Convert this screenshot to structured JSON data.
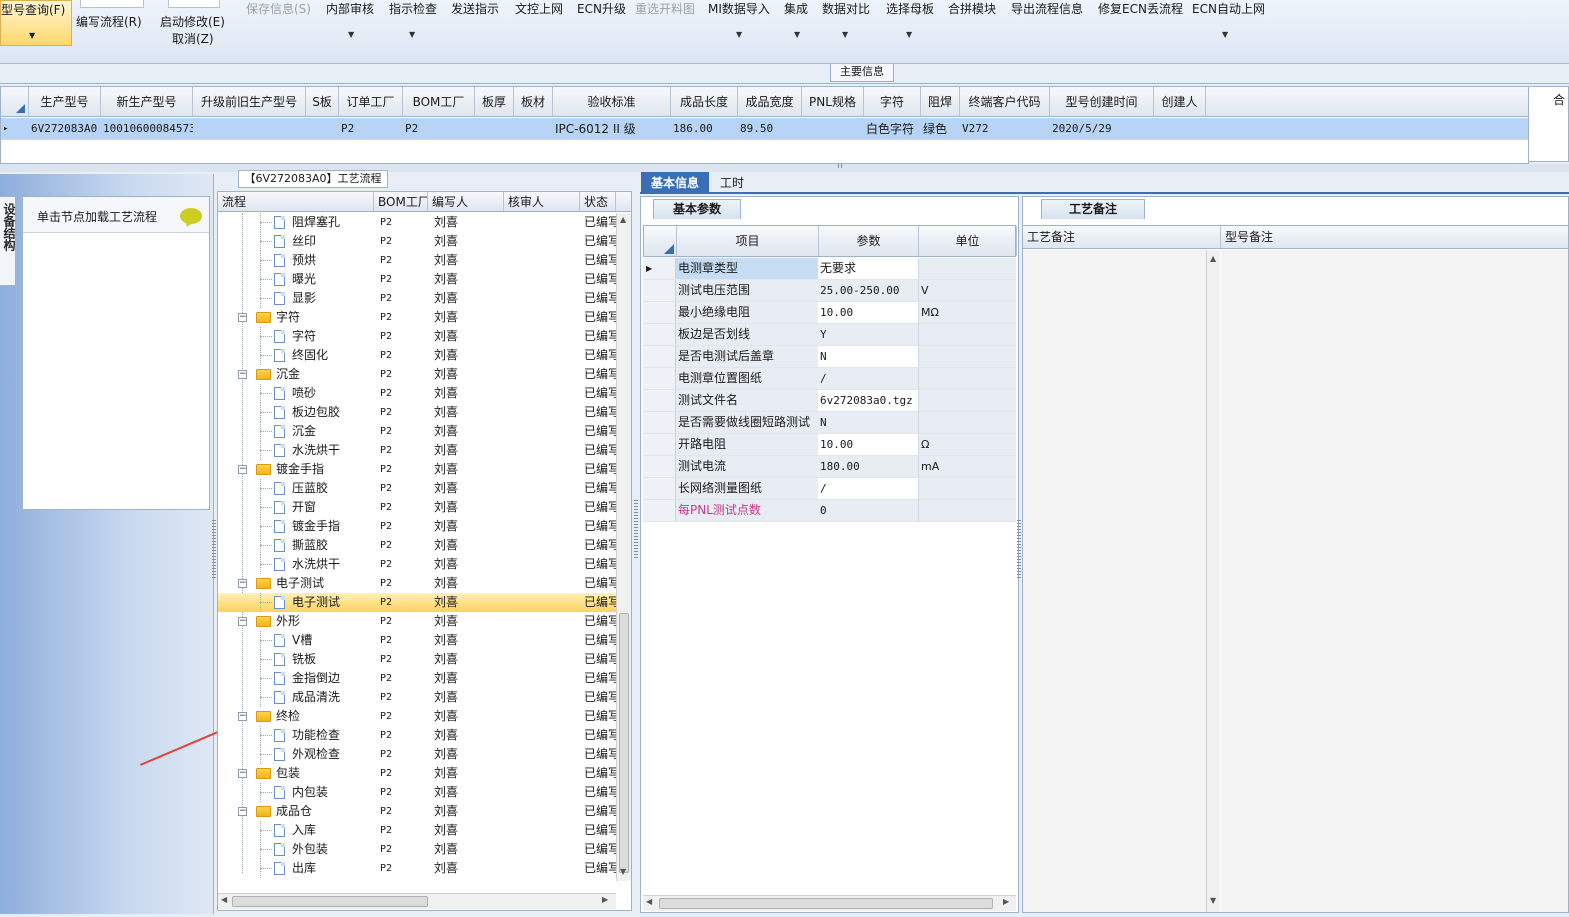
{
  "ribbon": {
    "items": [
      {
        "label": "型号查询(F)",
        "sub": "",
        "disabled": false,
        "dropdown": true
      },
      {
        "label": "编写流程(R)",
        "sub": "",
        "disabled": false,
        "dropdown": false
      },
      {
        "label": "启动修改(E)",
        "sub": "取消(Z)",
        "disabled": false,
        "dropdown": false
      },
      {
        "label": "保存信息(S)",
        "sub": "",
        "disabled": true,
        "dropdown": false
      },
      {
        "label": "内部审核",
        "sub": "",
        "disabled": false,
        "dropdown": true
      },
      {
        "label": "指示检查",
        "sub": "",
        "disabled": false,
        "dropdown": true
      },
      {
        "label": "发送指示",
        "sub": "",
        "disabled": false,
        "dropdown": false
      },
      {
        "label": "文控上网",
        "sub": "",
        "disabled": false,
        "dropdown": false
      },
      {
        "label": "ECN升级",
        "sub": "",
        "disabled": false,
        "dropdown": false
      },
      {
        "label": "重选开料图",
        "sub": "",
        "disabled": true,
        "dropdown": false
      },
      {
        "label": "MI数据导入",
        "sub": "",
        "disabled": false,
        "dropdown": true
      },
      {
        "label": "集成",
        "sub": "",
        "disabled": false,
        "dropdown": true
      },
      {
        "label": "数据对比",
        "sub": "",
        "disabled": false,
        "dropdown": true
      },
      {
        "label": "选择母板",
        "sub": "",
        "disabled": false,
        "dropdown": true
      },
      {
        "label": "合拼模块",
        "sub": "",
        "disabled": false,
        "dropdown": false
      },
      {
        "label": "导出流程信息",
        "sub": "",
        "disabled": false,
        "dropdown": false
      },
      {
        "label": "修复ECN丢流程",
        "sub": "",
        "disabled": false,
        "dropdown": false
      },
      {
        "label": "ECN自动上网",
        "sub": "",
        "disabled": false,
        "dropdown": true
      }
    ]
  },
  "main_info": {
    "tab_label": "主要信息",
    "columns": [
      "生产型号",
      "新生产型号",
      "升级前旧生产型号",
      "S板",
      "订单工厂",
      "BOM工厂",
      "板厚",
      "板材",
      "验收标准",
      "成品长度",
      "成品宽度",
      "PNL规格",
      "字符",
      "阻焊",
      "终端客户代码",
      "型号创建时间",
      "创建人"
    ],
    "row": [
      "6V272083A0",
      "10010600084573",
      "",
      "",
      "P2",
      "P2",
      "",
      "",
      "IPC-6012 II 级",
      "186.00",
      "89.50",
      "",
      "白色字符",
      "绿色",
      "V272",
      "2020/5/29",
      ""
    ],
    "right_header": "合"
  },
  "left_nav": {
    "vertical_tab": "设备结构",
    "node_hint": "单击节点加载工艺流程"
  },
  "process": {
    "title": "【6V272083A0】工艺流程",
    "columns": [
      "流程",
      "BOM工厂",
      "编写人",
      "核审人",
      "状态"
    ],
    "rows": [
      {
        "name": "阻焊塞孔",
        "level": 1,
        "folder": false,
        "factory": "P2",
        "writer": "刘喜",
        "reviewer": "",
        "status": "已编写"
      },
      {
        "name": "丝印",
        "level": 1,
        "folder": false,
        "factory": "P2",
        "writer": "刘喜",
        "reviewer": "",
        "status": "已编写"
      },
      {
        "name": "预烘",
        "level": 1,
        "folder": false,
        "factory": "P2",
        "writer": "刘喜",
        "reviewer": "",
        "status": "已编写"
      },
      {
        "name": "曝光",
        "level": 1,
        "folder": false,
        "factory": "P2",
        "writer": "刘喜",
        "reviewer": "",
        "status": "已编写"
      },
      {
        "name": "显影",
        "level": 1,
        "folder": false,
        "factory": "P2",
        "writer": "刘喜",
        "reviewer": "",
        "status": "已编写"
      },
      {
        "name": "字符",
        "level": 0,
        "folder": true,
        "factory": "P2",
        "writer": "刘喜",
        "reviewer": "",
        "status": "已编写"
      },
      {
        "name": "字符",
        "level": 1,
        "folder": false,
        "factory": "P2",
        "writer": "刘喜",
        "reviewer": "",
        "status": "已编写"
      },
      {
        "name": "终固化",
        "level": 1,
        "folder": false,
        "factory": "P2",
        "writer": "刘喜",
        "reviewer": "",
        "status": "已编写"
      },
      {
        "name": "沉金",
        "level": 0,
        "folder": true,
        "factory": "P2",
        "writer": "刘喜",
        "reviewer": "",
        "status": "已编写"
      },
      {
        "name": "喷砂",
        "level": 1,
        "folder": false,
        "factory": "P2",
        "writer": "刘喜",
        "reviewer": "",
        "status": "已编写"
      },
      {
        "name": "板边包胶",
        "level": 1,
        "folder": false,
        "factory": "P2",
        "writer": "刘喜",
        "reviewer": "",
        "status": "已编写"
      },
      {
        "name": "沉金",
        "level": 1,
        "folder": false,
        "factory": "P2",
        "writer": "刘喜",
        "reviewer": "",
        "status": "已编写"
      },
      {
        "name": "水洗烘干",
        "level": 1,
        "folder": false,
        "factory": "P2",
        "writer": "刘喜",
        "reviewer": "",
        "status": "已编写"
      },
      {
        "name": "镀金手指",
        "level": 0,
        "folder": true,
        "factory": "P2",
        "writer": "刘喜",
        "reviewer": "",
        "status": "已编写"
      },
      {
        "name": "压蓝胶",
        "level": 1,
        "folder": false,
        "factory": "P2",
        "writer": "刘喜",
        "reviewer": "",
        "status": "已编写"
      },
      {
        "name": "开窗",
        "level": 1,
        "folder": false,
        "factory": "P2",
        "writer": "刘喜",
        "reviewer": "",
        "status": "已编写"
      },
      {
        "name": "镀金手指",
        "level": 1,
        "folder": false,
        "factory": "P2",
        "writer": "刘喜",
        "reviewer": "",
        "status": "已编写"
      },
      {
        "name": "撕蓝胶",
        "level": 1,
        "folder": false,
        "factory": "P2",
        "writer": "刘喜",
        "reviewer": "",
        "status": "已编写"
      },
      {
        "name": "水洗烘干",
        "level": 1,
        "folder": false,
        "factory": "P2",
        "writer": "刘喜",
        "reviewer": "",
        "status": "已编写"
      },
      {
        "name": "电子测试",
        "level": 0,
        "folder": true,
        "factory": "P2",
        "writer": "刘喜",
        "reviewer": "",
        "status": "已编写"
      },
      {
        "name": "电子测试",
        "level": 1,
        "folder": false,
        "factory": "P2",
        "writer": "刘喜",
        "reviewer": "",
        "status": "已编写",
        "selected": true
      },
      {
        "name": "外形",
        "level": 0,
        "folder": true,
        "factory": "P2",
        "writer": "刘喜",
        "reviewer": "",
        "status": "已编写"
      },
      {
        "name": "V槽",
        "level": 1,
        "folder": false,
        "factory": "P2",
        "writer": "刘喜",
        "reviewer": "",
        "status": "已编写"
      },
      {
        "name": "铣板",
        "level": 1,
        "folder": false,
        "factory": "P2",
        "writer": "刘喜",
        "reviewer": "",
        "status": "已编写"
      },
      {
        "name": "金指倒边",
        "level": 1,
        "folder": false,
        "factory": "P2",
        "writer": "刘喜",
        "reviewer": "",
        "status": "已编写"
      },
      {
        "name": "成品清洗",
        "level": 1,
        "folder": false,
        "factory": "P2",
        "writer": "刘喜",
        "reviewer": "",
        "status": "已编写"
      },
      {
        "name": "终检",
        "level": 0,
        "folder": true,
        "factory": "P2",
        "writer": "刘喜",
        "reviewer": "",
        "status": "已编写"
      },
      {
        "name": "功能检查",
        "level": 1,
        "folder": false,
        "factory": "P2",
        "writer": "刘喜",
        "reviewer": "",
        "status": "已编写"
      },
      {
        "name": "外观检查",
        "level": 1,
        "folder": false,
        "factory": "P2",
        "writer": "刘喜",
        "reviewer": "",
        "status": "已编写"
      },
      {
        "name": "包装",
        "level": 0,
        "folder": true,
        "factory": "P2",
        "writer": "刘喜",
        "reviewer": "",
        "status": "已编写"
      },
      {
        "name": "内包装",
        "level": 1,
        "folder": false,
        "factory": "P2",
        "writer": "刘喜",
        "reviewer": "",
        "status": "已编写"
      },
      {
        "name": "成品仓",
        "level": 0,
        "folder": true,
        "factory": "P2",
        "writer": "刘喜",
        "reviewer": "",
        "status": "已编写"
      },
      {
        "name": "入库",
        "level": 1,
        "folder": false,
        "factory": "P2",
        "writer": "刘喜",
        "reviewer": "",
        "status": "已编写"
      },
      {
        "name": "外包装",
        "level": 1,
        "folder": false,
        "factory": "P2",
        "writer": "刘喜",
        "reviewer": "",
        "status": "已编写"
      },
      {
        "name": "出库",
        "level": 1,
        "folder": false,
        "factory": "P2",
        "writer": "刘喜",
        "reviewer": "",
        "status": "已编写"
      }
    ]
  },
  "tabs": {
    "basic": "基本信息",
    "work": "工时"
  },
  "params": {
    "tab": "基本参数",
    "columns": [
      "项目",
      "参数",
      "单位"
    ],
    "rows": [
      {
        "item": "电测章类型",
        "value": "无要求",
        "unit": ""
      },
      {
        "item": "测试电压范围",
        "value": "25.00-250.00",
        "unit": "V"
      },
      {
        "item": "最小绝缘电阻",
        "value": "10.00",
        "unit": "MΩ"
      },
      {
        "item": "板边是否划线",
        "value": "Y",
        "unit": ""
      },
      {
        "item": "是否电测试后盖章",
        "value": "N",
        "unit": ""
      },
      {
        "item": "电测章位置图纸",
        "value": "/",
        "unit": ""
      },
      {
        "item": "测试文件名",
        "value": "6v272083a0.tgz",
        "unit": ""
      },
      {
        "item": "是否需要做线圈短路测试",
        "value": "N",
        "unit": ""
      },
      {
        "item": "开路电阻",
        "value": "10.00",
        "unit": "Ω"
      },
      {
        "item": "测试电流",
        "value": "180.00",
        "unit": "mA"
      },
      {
        "item": "长网络测量图纸",
        "value": "/",
        "unit": ""
      },
      {
        "item": "每PNL测试点数",
        "value": "0",
        "unit": ""
      }
    ]
  },
  "notes": {
    "tab": "工艺备注",
    "col1": "工艺备注",
    "col2": "型号备注"
  },
  "colors": {
    "accent": "#3a6fb8",
    "selected_row": "#b7d3f5",
    "selected_tree": "#ffd25e",
    "annotation_arrow": "#e0443a",
    "highlight_item": "#c33b8c"
  }
}
